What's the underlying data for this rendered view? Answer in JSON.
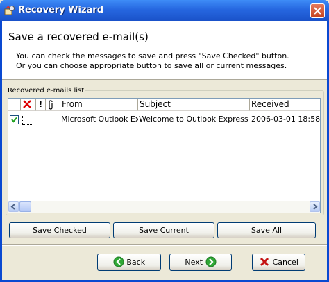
{
  "window": {
    "title": "Recovery Wizard"
  },
  "header": {
    "title": "Save a recovered e-mail(s)",
    "line1": "You can check the messages to save and press \"Save Checked\" button.",
    "line2": "Or you can choose appropriate button to save all or current messages."
  },
  "list": {
    "group_label": "Recovered e-mails list",
    "columns": {
      "from": "From",
      "subject": "Subject",
      "received": "Received"
    },
    "rows": [
      {
        "checked": true,
        "from": "Microsoft Outlook Ex",
        "subject": "Welcome to Outlook Express",
        "received": "2006-03-01 18:58:"
      }
    ]
  },
  "actions": {
    "save_checked": "Save Checked",
    "save_current": "Save Current",
    "save_all": "Save All"
  },
  "nav": {
    "back": "Back",
    "next": "Next",
    "cancel": "Cancel"
  },
  "icons": {
    "title": "wizard-app-icon",
    "close": "close-icon",
    "delete_col": "red-x-icon",
    "priority_col": "exclamation-icon",
    "attach_col": "paperclip-icon",
    "back": "green-arrow-left-icon",
    "next": "green-arrow-right-icon",
    "cancel": "red-x-icon"
  }
}
